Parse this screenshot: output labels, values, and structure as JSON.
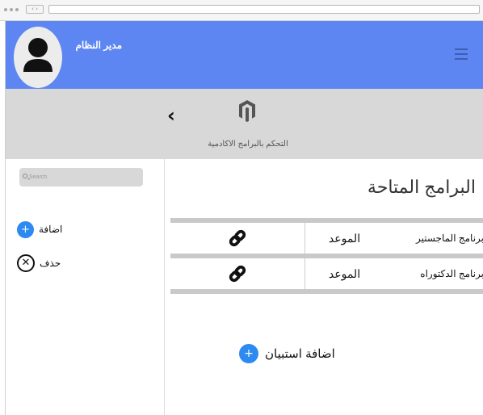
{
  "window": {
    "header": {
      "admin_name": "مدير النظام",
      "avatar_icon": "user-icon",
      "menu_icon": "hamburger-icon",
      "color": "#5d86f2"
    },
    "subheader": {
      "back_icon": "chevron-left-icon",
      "logo_icon": "magento-logo-icon",
      "caption": "التحكم بالبرامج الاكادمية",
      "color": "#d8d8d8"
    },
    "sidebar": {
      "search": {
        "placeholder": "Search",
        "value": ""
      },
      "items": [
        {
          "label": "اضافة",
          "icon": "plus-circle-icon"
        },
        {
          "label": "حذف",
          "icon": "x-circle-icon"
        }
      ]
    },
    "main": {
      "title": "البرامج المتاحة",
      "programs": [
        {
          "name": "برنامج الماجستير",
          "date_label": "الموعد",
          "link_icon": "link-icon"
        },
        {
          "name": "برنامج الدكتوراه",
          "date_label": "الموعد",
          "link_icon": "link-icon"
        }
      ],
      "add_survey_label": "اضافة استبيان",
      "accent": "#2d8af0"
    }
  }
}
